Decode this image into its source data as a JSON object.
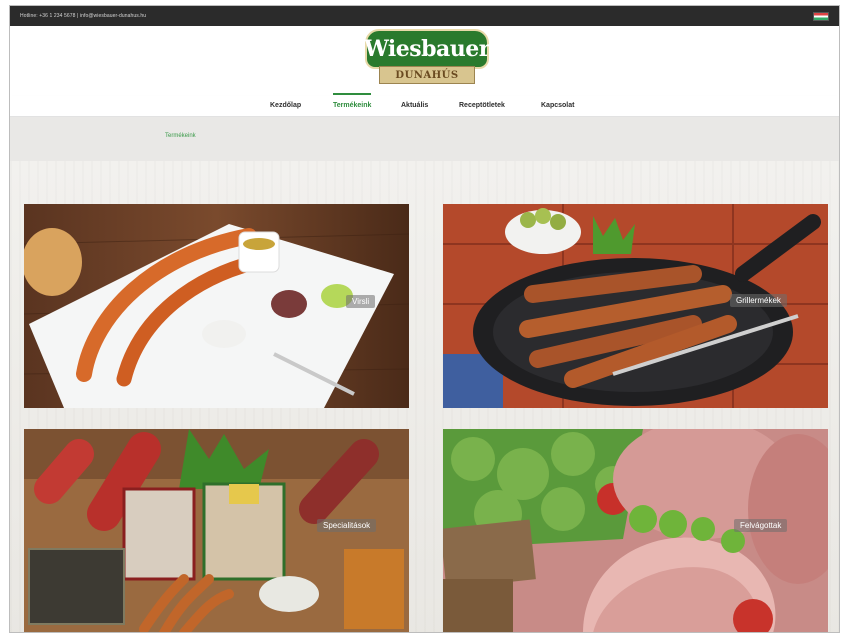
{
  "topbar": {
    "contact_text": "Hotline: +36 1 234 5678  |  info@wiesbauer-dunahus.hu",
    "language_flag": "hu-flag-icon"
  },
  "logo": {
    "brand": "Wiesbauer",
    "sub": "DUNAHÚS",
    "colors": {
      "badge": "#2a7a2d",
      "ribbon": "#d8c58f"
    }
  },
  "nav": {
    "items": [
      {
        "label": "Kezdőlap",
        "active": false
      },
      {
        "label": "Termékeink",
        "active": true
      },
      {
        "label": "Aktuális",
        "active": false
      },
      {
        "label": "Receptötletek",
        "active": false
      },
      {
        "label": "Kapcsolat",
        "active": false
      }
    ],
    "accent": "#2f8d3e"
  },
  "breadcrumb": {
    "current": "Termékeink"
  },
  "products": {
    "tiles": [
      {
        "label": "Virsli"
      },
      {
        "label": "Grillermékek"
      },
      {
        "label": "Specialitások"
      },
      {
        "label": "Felvágottak"
      }
    ]
  }
}
